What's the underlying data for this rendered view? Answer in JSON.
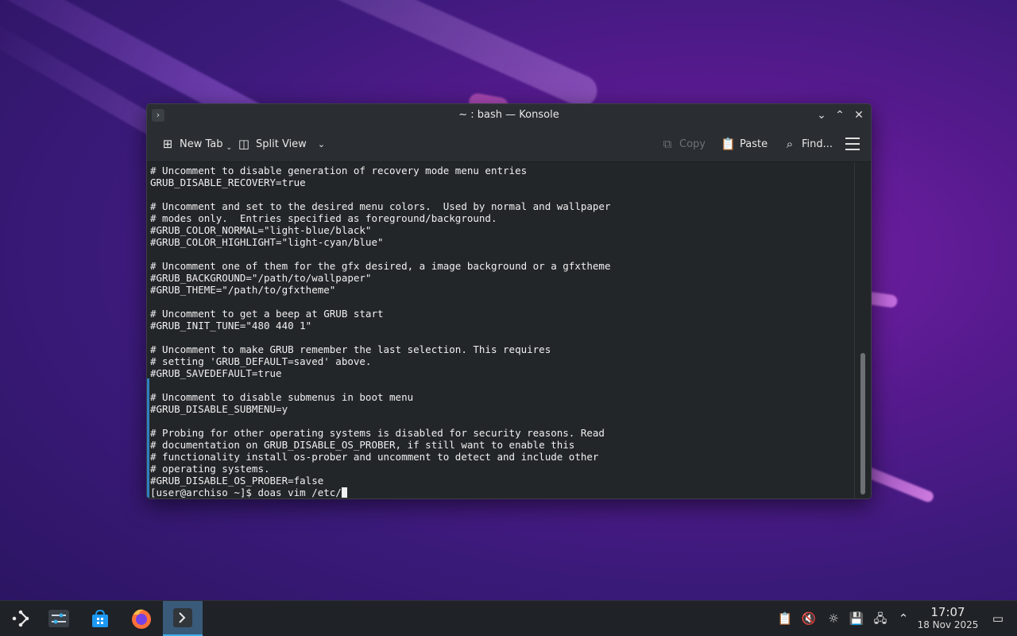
{
  "window": {
    "title": "~ : bash — Konsole"
  },
  "toolbar": {
    "new_tab_label": "New Tab",
    "split_view_label": "Split View",
    "copy_label": "Copy",
    "paste_label": "Paste",
    "find_label": "Find..."
  },
  "terminal": {
    "lines": [
      "# Uncomment to disable generation of recovery mode menu entries",
      "GRUB_DISABLE_RECOVERY=true",
      "",
      "# Uncomment and set to the desired menu colors.  Used by normal and wallpaper",
      "# modes only.  Entries specified as foreground/background.",
      "#GRUB_COLOR_NORMAL=\"light-blue/black\"",
      "#GRUB_COLOR_HIGHLIGHT=\"light-cyan/blue\"",
      "",
      "# Uncomment one of them for the gfx desired, a image background or a gfxtheme",
      "#GRUB_BACKGROUND=\"/path/to/wallpaper\"",
      "#GRUB_THEME=\"/path/to/gfxtheme\"",
      "",
      "# Uncomment to get a beep at GRUB start",
      "#GRUB_INIT_TUNE=\"480 440 1\"",
      "",
      "# Uncomment to make GRUB remember the last selection. This requires",
      "# setting 'GRUB_DEFAULT=saved' above.",
      "#GRUB_SAVEDEFAULT=true",
      "",
      "# Uncomment to disable submenus in boot menu",
      "#GRUB_DISABLE_SUBMENU=y",
      "",
      "# Probing for other operating systems is disabled for security reasons. Read",
      "# documentation on GRUB_DISABLE_OS_PROBER, if still want to enable this",
      "# functionality install os-prober and uncomment to detect and include other",
      "# operating systems.",
      "#GRUB_DISABLE_OS_PROBER=false"
    ],
    "prompt": "[user@archiso ~]$ doas vim /etc/"
  },
  "taskbar": {
    "clock_time": "17:07",
    "clock_date": "18 Nov 2025"
  },
  "colors": {
    "accent": "#3daee9",
    "terminal_bg": "#232629",
    "marker": "#2f7fc1"
  }
}
